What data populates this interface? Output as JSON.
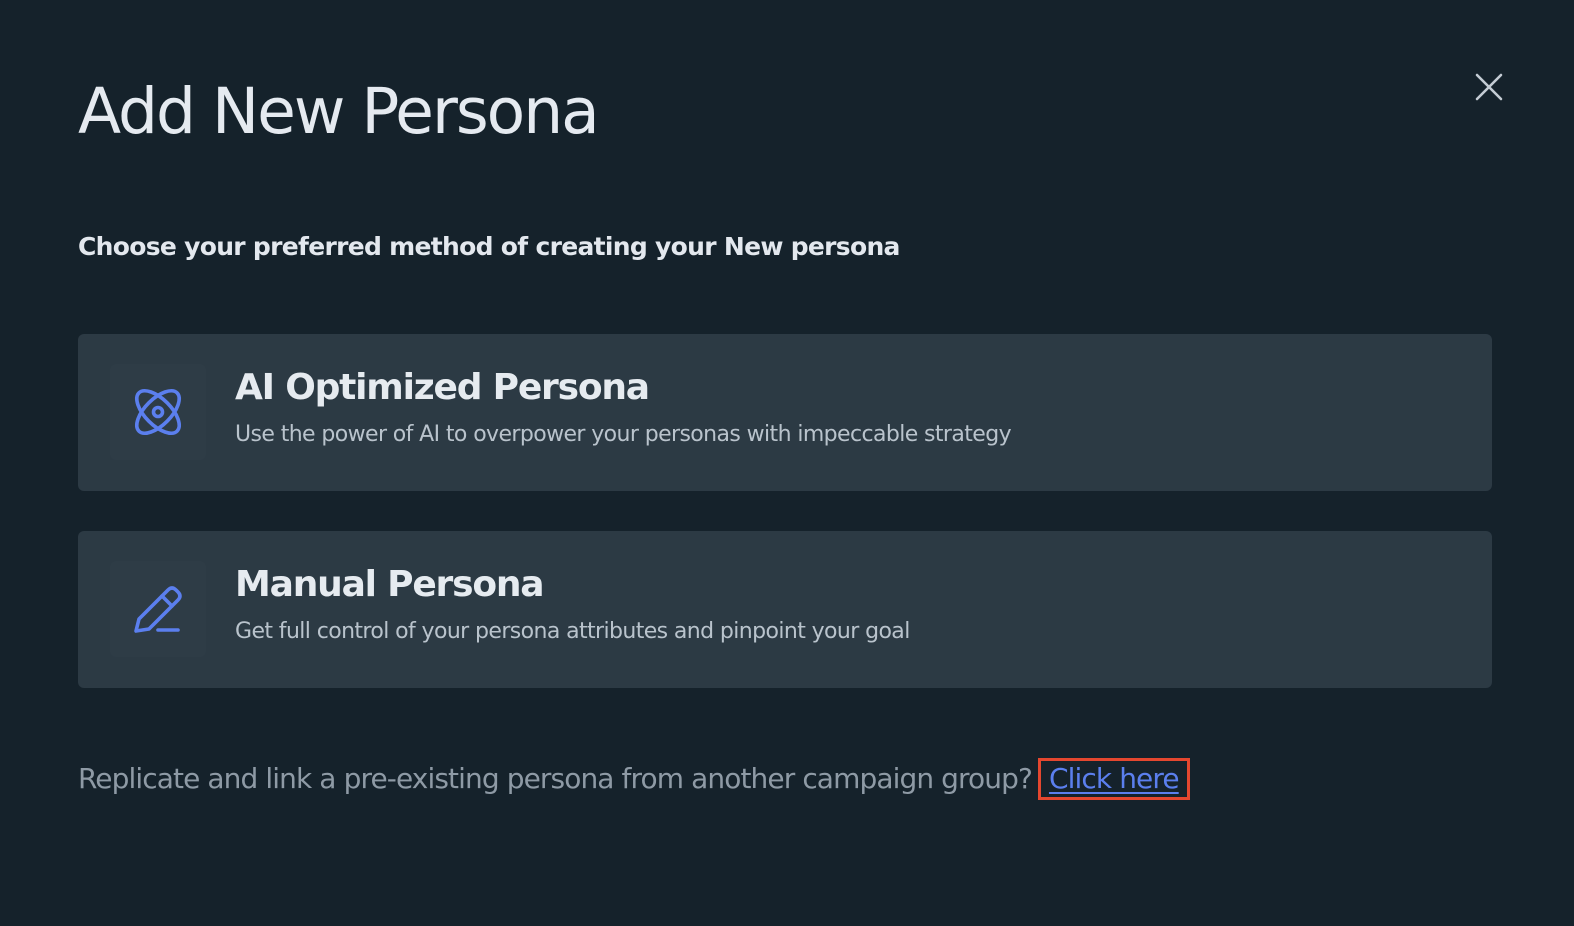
{
  "modal": {
    "title": "Add New Persona",
    "subtitle": "Choose your preferred method of creating your New persona",
    "close_icon": "close-icon"
  },
  "options": [
    {
      "icon": "atom-icon",
      "title": "AI Optimized Persona",
      "description": "Use the power of AI to overpower your personas with impeccable strategy"
    },
    {
      "icon": "pen-icon",
      "title": "Manual Persona",
      "description": "Get full control of your persona attributes and pinpoint your goal"
    }
  ],
  "footer": {
    "prompt": "Replicate and link a pre-existing persona from another campaign group?",
    "link_label": "Click here"
  },
  "colors": {
    "background": "#15222b",
    "card": "#2c3a44",
    "accent": "#5b7fee",
    "highlight_border": "#e4472f"
  }
}
